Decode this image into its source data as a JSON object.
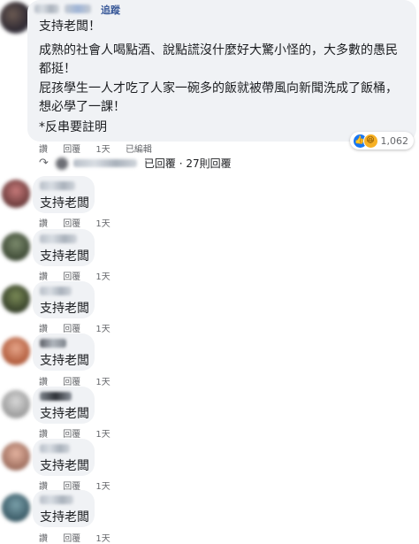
{
  "main_comment": {
    "follow_label": "追蹤",
    "paragraphs": [
      "支持老闆！",
      "成熟的社會人喝點酒、說點謊沒什麼好大驚小怪的，大多數的愚民都挺！",
      "屁孩學生一人才吃了人家一碗多的飯就被帶風向新聞洗成了飯桶，想必學了一課！",
      "*反串要註明"
    ],
    "actions": {
      "like": "讚",
      "reply": "回覆",
      "time": "1天",
      "edited": "已編輯"
    },
    "reaction_count": "1,062",
    "reaction_icons": [
      "like-icon",
      "haha-icon"
    ]
  },
  "replies_summary": {
    "text": "已回覆 · 27則回覆"
  },
  "colors": {
    "bubble": "#f0f2f5",
    "link": "#385898",
    "meta": "#65676b",
    "like": "#1877f2",
    "haha": "#f7b125"
  },
  "replies": [
    {
      "text": "支持老闆",
      "like": "讚",
      "reply": "回覆",
      "time": "1天"
    },
    {
      "text": "支持老闆",
      "like": "讚",
      "reply": "回覆",
      "time": "1天"
    },
    {
      "text": "支持老闆",
      "like": "讚",
      "reply": "回覆",
      "time": "1天"
    },
    {
      "text": "支持老闆",
      "like": "讚",
      "reply": "回覆",
      "time": "1天"
    },
    {
      "text": "支持老闆",
      "like": "讚",
      "reply": "回覆",
      "time": "1天"
    },
    {
      "text": "支持老闆",
      "like": "讚",
      "reply": "回覆",
      "time": "1天"
    },
    {
      "text": "支持老闆",
      "like": "讚",
      "reply": "回覆",
      "time": "1天"
    }
  ]
}
